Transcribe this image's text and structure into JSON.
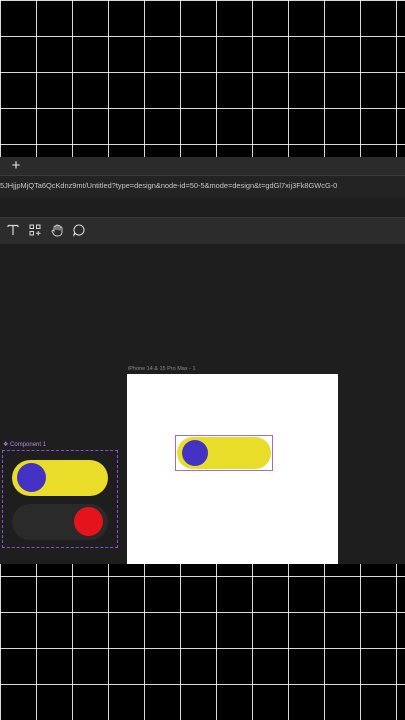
{
  "browser": {
    "new_tab_label": "+",
    "url": "5JHjjpMjQTa6QcKdnz9mt/Untitled?type=design&node-id=50-5&mode=design&t=gdGl7xij3Fk8GWcG-0"
  },
  "toolbar": {
    "tools": [
      "text-tool",
      "component-tool",
      "hand-tool",
      "comment-tool"
    ],
    "text_tool_glyph": "T"
  },
  "canvas": {
    "frame_label": "iPhone 14 & 15 Pro Max - 1",
    "component_label": "❖ Component 1",
    "toggle": {
      "on_track_color": "#e9dd2a",
      "on_knob_color": "#4432c4",
      "off_track_color": "#2a2a2a",
      "off_knob_color": "#e5141c"
    }
  }
}
